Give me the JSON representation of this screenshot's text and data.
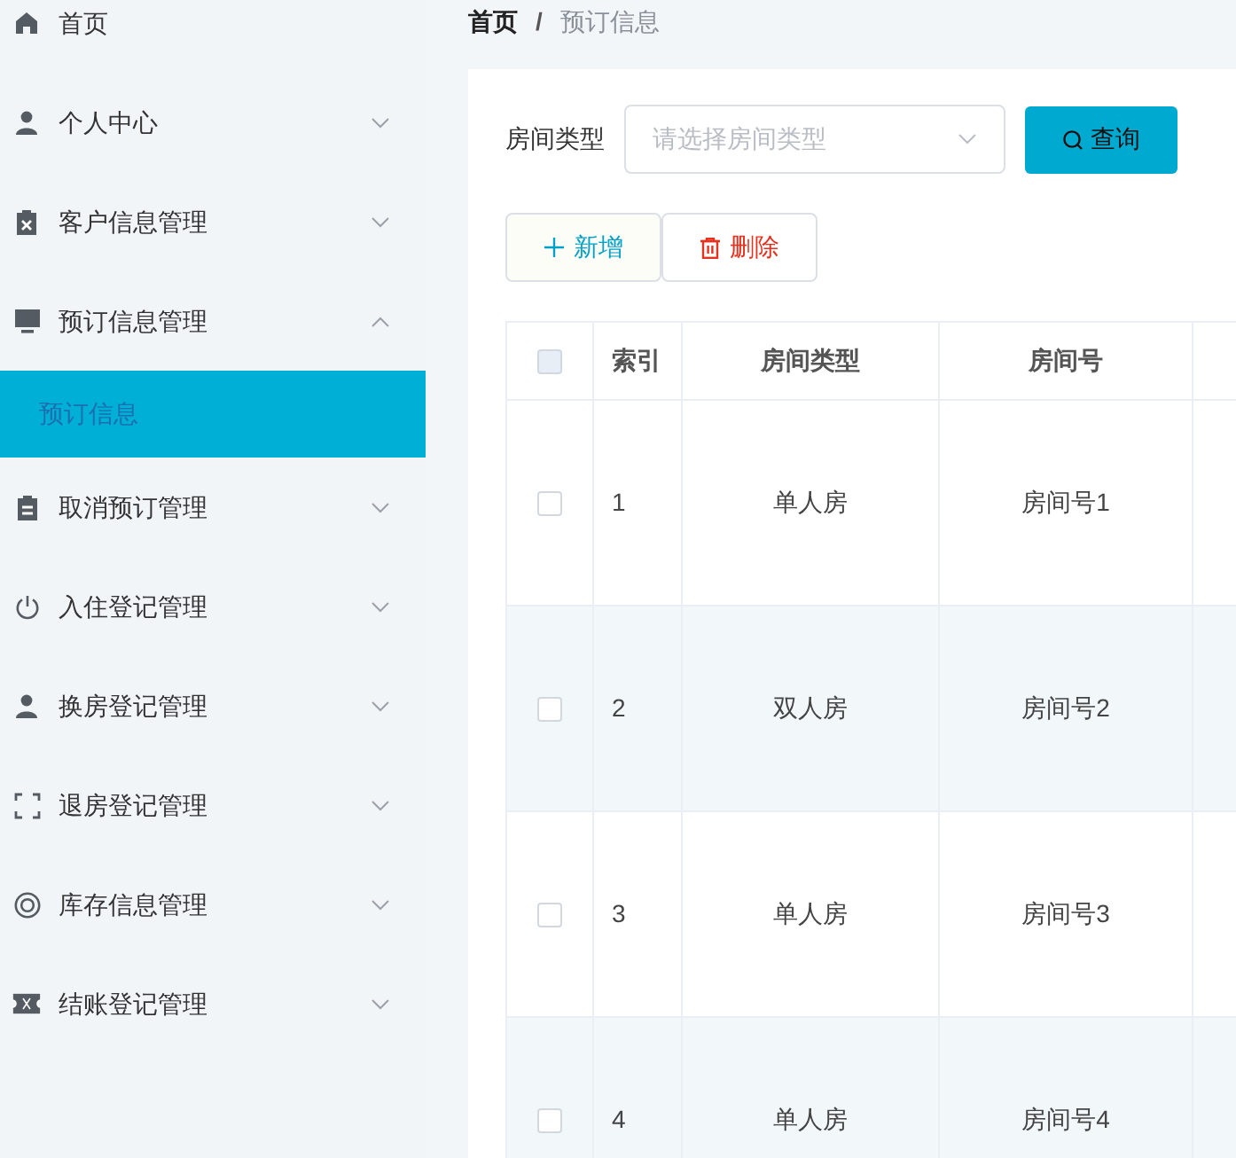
{
  "sidebar": {
    "items": [
      {
        "label": "首页"
      },
      {
        "label": "个人中心",
        "expanded": false
      },
      {
        "label": "客户信息管理",
        "expanded": false
      },
      {
        "label": "预订信息管理",
        "expanded": true,
        "children": [
          {
            "label": "预订信息",
            "selected": true
          }
        ]
      },
      {
        "label": "取消预订管理",
        "expanded": false
      },
      {
        "label": "入住登记管理",
        "expanded": false
      },
      {
        "label": "换房登记管理",
        "expanded": false
      },
      {
        "label": "退房登记管理",
        "expanded": false
      },
      {
        "label": "库存信息管理",
        "expanded": false
      },
      {
        "label": "结账登记管理",
        "expanded": false
      }
    ]
  },
  "breadcrumb": {
    "home": "首页",
    "separator": "/",
    "current": "预订信息"
  },
  "filter": {
    "label": "房间类型",
    "placeholder": "请选择房间类型",
    "search_button": "查询"
  },
  "actions": {
    "add": "新增",
    "delete": "删除"
  },
  "table": {
    "select_all": {
      "checked": false
    },
    "columns": [
      "索引",
      "房间类型",
      "房间号"
    ],
    "rows": [
      {
        "checked": false,
        "cells": [
          "1",
          "单人房",
          "房间号1"
        ]
      },
      {
        "checked": false,
        "cells": [
          "2",
          "双人房",
          "房间号2"
        ]
      },
      {
        "checked": false,
        "cells": [
          "3",
          "单人房",
          "房间号3"
        ]
      },
      {
        "checked": false,
        "cells": [
          "4",
          "单人房",
          "房间号4"
        ]
      }
    ]
  }
}
